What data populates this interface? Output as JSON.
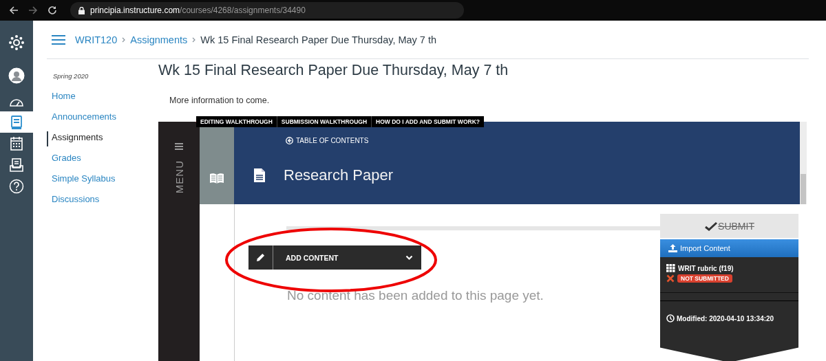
{
  "browser": {
    "url_host": "principia.instructure.com",
    "url_path": "/courses/4268/assignments/34490"
  },
  "global_nav": {
    "items": [
      {
        "kind": "logo",
        "selected": false
      },
      {
        "kind": "account",
        "selected": false
      },
      {
        "kind": "dashboard",
        "selected": false
      },
      {
        "kind": "courses",
        "selected": true
      },
      {
        "kind": "calendar",
        "selected": false
      },
      {
        "kind": "inbox",
        "selected": false
      },
      {
        "kind": "help",
        "selected": false
      }
    ]
  },
  "breadcrumb": [
    "WRIT120",
    "Assignments",
    "Wk 15 Final Research Paper Due Thursday, May 7 th"
  ],
  "course_nav": {
    "term": "Spring 2020",
    "items": [
      {
        "label": "Home",
        "selected": false
      },
      {
        "label": "Announcements",
        "selected": false
      },
      {
        "label": "Assignments",
        "selected": true
      },
      {
        "label": "Grades",
        "selected": false
      },
      {
        "label": "Simple Syllabus",
        "selected": false
      },
      {
        "label": "Discussions",
        "selected": false
      }
    ]
  },
  "page_title": "Wk 15 Final Research Paper Due Thursday, May 7 th",
  "description": "More information to come.",
  "tool": {
    "tabs": [
      "EDITING WALKTHROUGH",
      "SUBMISSION WALKTHROUGH",
      "HOW DO I ADD AND SUBMIT WORK?"
    ],
    "menu_label": "MENU",
    "toc_link": "TABLE OF CONTENTS",
    "page_heading": "Research Paper",
    "add_content": "ADD CONTENT",
    "empty_message": "No content has been added to this page yet.",
    "submit": {
      "label": "SUBMIT",
      "disabled": true
    },
    "import_button": "Import Content",
    "rubric": "WRIT rubric (f19)",
    "status": "NOT SUBMITTED",
    "modified": "Modified: 2020-04-10 13:34:20"
  },
  "annotations": [
    {
      "kind": "ellipse"
    }
  ]
}
